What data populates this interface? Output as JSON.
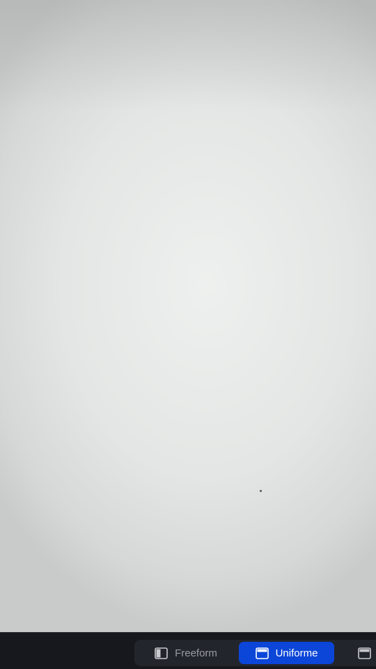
{
  "toolbar": {
    "layout_options": [
      {
        "label": "Freeform",
        "icon": "layout-freeform-icon",
        "selected": false
      },
      {
        "label": "Uniforme",
        "icon": "layout-uniform-icon",
        "selected": true
      },
      {
        "label": "",
        "icon": "layout-other-icon",
        "selected": false
      }
    ]
  },
  "colors": {
    "accent": "#0b46d8",
    "bar_background": "#16181e",
    "canvas": "#e4e6e5"
  }
}
